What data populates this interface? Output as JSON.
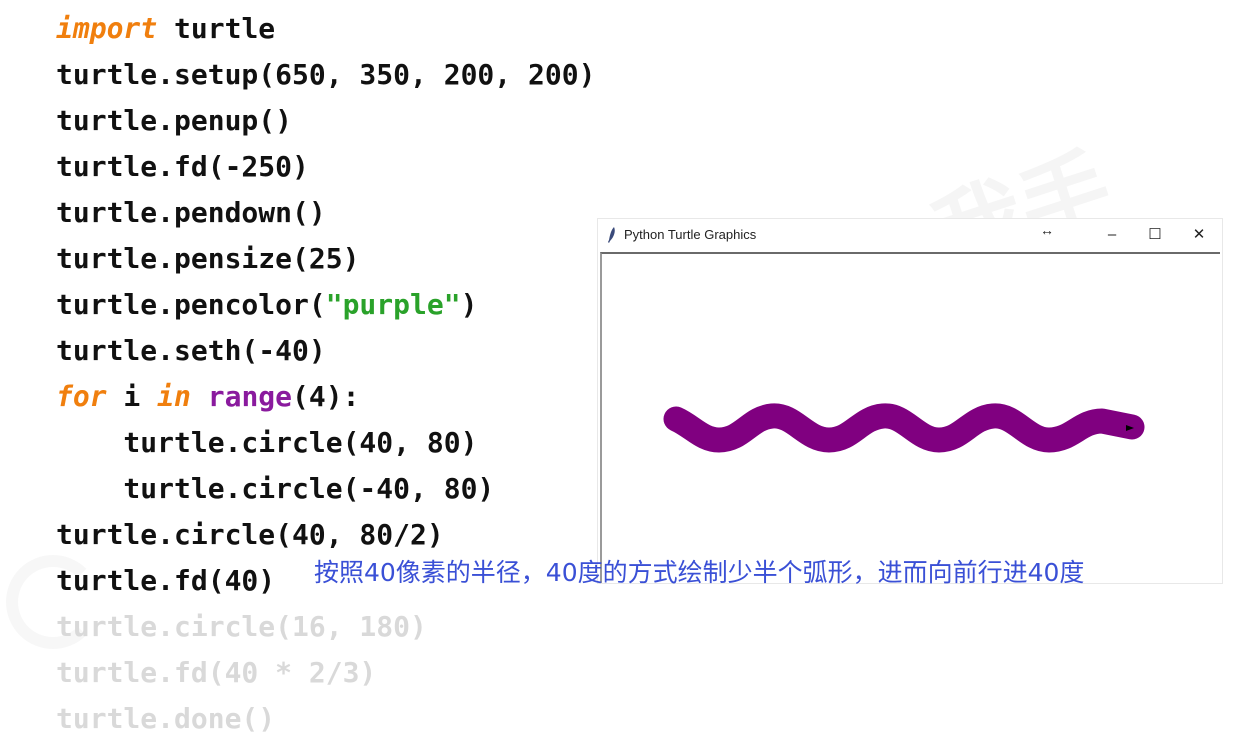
{
  "code_lines": [
    [
      {
        "t": "import",
        "c": "kw"
      },
      {
        "t": " turtle",
        "c": ""
      }
    ],
    [
      {
        "t": "turtle.setup(650, 350, 200, 200)",
        "c": ""
      }
    ],
    [
      {
        "t": "turtle.penup()",
        "c": ""
      }
    ],
    [
      {
        "t": "turtle.fd(-250)",
        "c": ""
      }
    ],
    [
      {
        "t": "turtle.pendown()",
        "c": ""
      }
    ],
    [
      {
        "t": "turtle.pensize(25)",
        "c": ""
      }
    ],
    [
      {
        "t": "turtle.pencolor(",
        "c": ""
      },
      {
        "t": "\"purple\"",
        "c": "str"
      },
      {
        "t": ")",
        "c": ""
      }
    ],
    [
      {
        "t": "turtle.seth(-40)",
        "c": ""
      }
    ],
    [
      {
        "t": "for",
        "c": "kw"
      },
      {
        "t": " i ",
        "c": ""
      },
      {
        "t": "in",
        "c": "kw"
      },
      {
        "t": " ",
        "c": ""
      },
      {
        "t": "range",
        "c": "fn"
      },
      {
        "t": "(4):",
        "c": ""
      }
    ],
    [
      {
        "t": "    turtle.circle(40, 80)",
        "c": ""
      }
    ],
    [
      {
        "t": "    turtle.circle(-40, 80)",
        "c": ""
      }
    ],
    [
      {
        "t": "turtle.circle(40, 80/2)",
        "c": ""
      }
    ],
    [
      {
        "t": "turtle.fd(40)",
        "c": ""
      }
    ],
    [
      {
        "t": "turtle.circle(16, 180)",
        "c": "faded"
      }
    ],
    [
      {
        "t": "turtle.fd(40 * 2/3)",
        "c": "faded"
      }
    ],
    [
      {
        "t": "turtle.done()",
        "c": "faded"
      }
    ]
  ],
  "turtle_window": {
    "title": "Python Turtle Graphics",
    "resize_glyph": "↔",
    "minimize_glyph": "–",
    "maximize_glyph": "☐",
    "close_glyph": "✕",
    "pen_color": "#800080"
  },
  "caption": "按照40像素的半径，40度的方式绘制少半个弧形，进而向前行进40度",
  "colors": {
    "keyword": "#f07f0e",
    "builtin": "#8a1a9e",
    "string": "#2aa22a",
    "caption": "#3a50d6",
    "faded": "#d9d9d9"
  }
}
